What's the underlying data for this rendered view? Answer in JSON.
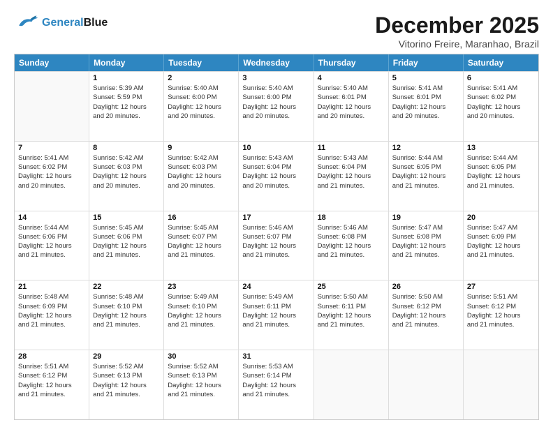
{
  "header": {
    "logo_general": "General",
    "logo_blue": "Blue",
    "main_title": "December 2025",
    "subtitle": "Vitorino Freire, Maranhao, Brazil"
  },
  "days_of_week": [
    "Sunday",
    "Monday",
    "Tuesday",
    "Wednesday",
    "Thursday",
    "Friday",
    "Saturday"
  ],
  "weeks": [
    [
      {
        "day": "",
        "info": ""
      },
      {
        "day": "1",
        "info": "Sunrise: 5:39 AM\nSunset: 5:59 PM\nDaylight: 12 hours\nand 20 minutes."
      },
      {
        "day": "2",
        "info": "Sunrise: 5:40 AM\nSunset: 6:00 PM\nDaylight: 12 hours\nand 20 minutes."
      },
      {
        "day": "3",
        "info": "Sunrise: 5:40 AM\nSunset: 6:00 PM\nDaylight: 12 hours\nand 20 minutes."
      },
      {
        "day": "4",
        "info": "Sunrise: 5:40 AM\nSunset: 6:01 PM\nDaylight: 12 hours\nand 20 minutes."
      },
      {
        "day": "5",
        "info": "Sunrise: 5:41 AM\nSunset: 6:01 PM\nDaylight: 12 hours\nand 20 minutes."
      },
      {
        "day": "6",
        "info": "Sunrise: 5:41 AM\nSunset: 6:02 PM\nDaylight: 12 hours\nand 20 minutes."
      }
    ],
    [
      {
        "day": "7",
        "info": "Sunrise: 5:41 AM\nSunset: 6:02 PM\nDaylight: 12 hours\nand 20 minutes."
      },
      {
        "day": "8",
        "info": "Sunrise: 5:42 AM\nSunset: 6:03 PM\nDaylight: 12 hours\nand 20 minutes."
      },
      {
        "day": "9",
        "info": "Sunrise: 5:42 AM\nSunset: 6:03 PM\nDaylight: 12 hours\nand 20 minutes."
      },
      {
        "day": "10",
        "info": "Sunrise: 5:43 AM\nSunset: 6:04 PM\nDaylight: 12 hours\nand 20 minutes."
      },
      {
        "day": "11",
        "info": "Sunrise: 5:43 AM\nSunset: 6:04 PM\nDaylight: 12 hours\nand 21 minutes."
      },
      {
        "day": "12",
        "info": "Sunrise: 5:44 AM\nSunset: 6:05 PM\nDaylight: 12 hours\nand 21 minutes."
      },
      {
        "day": "13",
        "info": "Sunrise: 5:44 AM\nSunset: 6:05 PM\nDaylight: 12 hours\nand 21 minutes."
      }
    ],
    [
      {
        "day": "14",
        "info": "Sunrise: 5:44 AM\nSunset: 6:06 PM\nDaylight: 12 hours\nand 21 minutes."
      },
      {
        "day": "15",
        "info": "Sunrise: 5:45 AM\nSunset: 6:06 PM\nDaylight: 12 hours\nand 21 minutes."
      },
      {
        "day": "16",
        "info": "Sunrise: 5:45 AM\nSunset: 6:07 PM\nDaylight: 12 hours\nand 21 minutes."
      },
      {
        "day": "17",
        "info": "Sunrise: 5:46 AM\nSunset: 6:07 PM\nDaylight: 12 hours\nand 21 minutes."
      },
      {
        "day": "18",
        "info": "Sunrise: 5:46 AM\nSunset: 6:08 PM\nDaylight: 12 hours\nand 21 minutes."
      },
      {
        "day": "19",
        "info": "Sunrise: 5:47 AM\nSunset: 6:08 PM\nDaylight: 12 hours\nand 21 minutes."
      },
      {
        "day": "20",
        "info": "Sunrise: 5:47 AM\nSunset: 6:09 PM\nDaylight: 12 hours\nand 21 minutes."
      }
    ],
    [
      {
        "day": "21",
        "info": "Sunrise: 5:48 AM\nSunset: 6:09 PM\nDaylight: 12 hours\nand 21 minutes."
      },
      {
        "day": "22",
        "info": "Sunrise: 5:48 AM\nSunset: 6:10 PM\nDaylight: 12 hours\nand 21 minutes."
      },
      {
        "day": "23",
        "info": "Sunrise: 5:49 AM\nSunset: 6:10 PM\nDaylight: 12 hours\nand 21 minutes."
      },
      {
        "day": "24",
        "info": "Sunrise: 5:49 AM\nSunset: 6:11 PM\nDaylight: 12 hours\nand 21 minutes."
      },
      {
        "day": "25",
        "info": "Sunrise: 5:50 AM\nSunset: 6:11 PM\nDaylight: 12 hours\nand 21 minutes."
      },
      {
        "day": "26",
        "info": "Sunrise: 5:50 AM\nSunset: 6:12 PM\nDaylight: 12 hours\nand 21 minutes."
      },
      {
        "day": "27",
        "info": "Sunrise: 5:51 AM\nSunset: 6:12 PM\nDaylight: 12 hours\nand 21 minutes."
      }
    ],
    [
      {
        "day": "28",
        "info": "Sunrise: 5:51 AM\nSunset: 6:12 PM\nDaylight: 12 hours\nand 21 minutes."
      },
      {
        "day": "29",
        "info": "Sunrise: 5:52 AM\nSunset: 6:13 PM\nDaylight: 12 hours\nand 21 minutes."
      },
      {
        "day": "30",
        "info": "Sunrise: 5:52 AM\nSunset: 6:13 PM\nDaylight: 12 hours\nand 21 minutes."
      },
      {
        "day": "31",
        "info": "Sunrise: 5:53 AM\nSunset: 6:14 PM\nDaylight: 12 hours\nand 21 minutes."
      },
      {
        "day": "",
        "info": ""
      },
      {
        "day": "",
        "info": ""
      },
      {
        "day": "",
        "info": ""
      }
    ]
  ]
}
